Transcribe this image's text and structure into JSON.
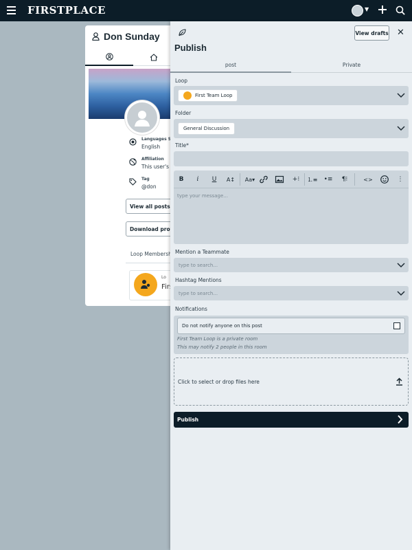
{
  "topbar": {
    "brand": "FIRSTPLACE"
  },
  "profile": {
    "name": "Don Sunday",
    "languages_label": "Languages Sp",
    "languages_value": "English",
    "affiliation_label": "Affiliation",
    "affiliation_value": "This user's e",
    "tag_label": "Tag",
    "tag_value": "@don",
    "view_posts_button": "View all posts an",
    "download_profile_button": "Download profile",
    "loop_memberships": "Loop Membershi",
    "loop_card_label": "Lo",
    "loop_card_name": "Firs"
  },
  "publish_panel": {
    "title": "Publish",
    "view_drafts_button": "View drafts",
    "tabs": [
      {
        "label": "post",
        "active": true
      },
      {
        "label": "Private",
        "active": false
      }
    ],
    "loop_label": "Loop",
    "loop_value": "First Team Loop",
    "folder_label": "Folder",
    "folder_value": "General Discussion",
    "title_label": "Title*",
    "title_value": "",
    "editor_placeholder": "type your message...",
    "mention_label": "Mention a Teammate",
    "mention_placeholder": "type to search...",
    "hashtag_label": "Hashtag Mentions",
    "hashtag_placeholder": "type to search...",
    "notifications_label": "Notifications",
    "do_not_notify": "Do not notify anyone on this post",
    "do_not_notify_checked": false,
    "private_note": "First Team Loop is a private room",
    "notify_note": "This may notify 2 people in this room",
    "dropzone_text": "Click to select or drop files here",
    "publish_button": "Publish"
  },
  "colors": {
    "topbar": "#0c1d28",
    "page_background": "#aab8c0",
    "panel_background": "#e9eef2",
    "field_background": "#ccd5dc",
    "loop_accent": "#f4a71d"
  }
}
